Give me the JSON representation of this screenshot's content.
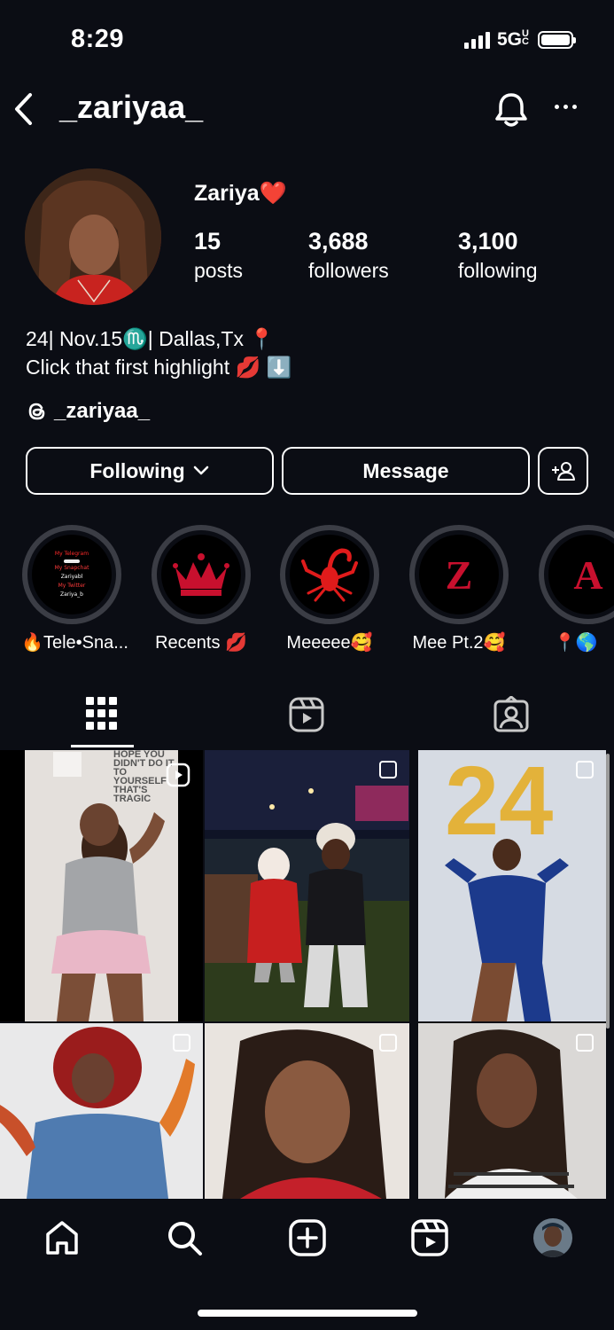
{
  "status": {
    "time": "8:29",
    "network": "5G",
    "network_suffix": "UC"
  },
  "header": {
    "username": "_zariyaa_"
  },
  "profile": {
    "display_name": "Zariya",
    "name_emoji": "❤️",
    "stats": [
      {
        "value": "15",
        "label": "posts"
      },
      {
        "value": "3,688",
        "label": "followers"
      },
      {
        "value": "3,100",
        "label": "following"
      }
    ],
    "bio_line1": "24| Nov.15♏️| Dallas,Tx 📍",
    "bio_line2": "Click that first highlight 💋 ⬇️",
    "threads_handle": "_zariyaa_"
  },
  "actions": {
    "following_label": "Following",
    "message_label": "Message"
  },
  "highlights": [
    {
      "label": "🔥Tele•Sna...",
      "cover_lines": [
        "My Telegram",
        "My Snapchat",
        "Zariyabl",
        "My Twitter",
        "Zariya_b"
      ]
    },
    {
      "label": "Recents 💋",
      "cover": "crown"
    },
    {
      "label": "Meeeee🥰",
      "cover": "scorpion"
    },
    {
      "label": "Mee Pt.2🥰",
      "cover_letter": "Z"
    },
    {
      "label": "📍🌎",
      "cover_letter": "A"
    }
  ],
  "post_overlay_text": "HOPE YOU DIDN'T DO IT TO YOURSELF THAT'S TRAGIC",
  "colors": {
    "background": "#0b0d14",
    "accent_red": "#c8102e",
    "ring": "#3b3d45"
  },
  "icons": [
    "back-icon",
    "bell-icon",
    "more-icon",
    "threads-icon",
    "chevron-down-icon",
    "add-person-icon",
    "grid-icon",
    "reels-icon",
    "tagged-icon",
    "home-icon",
    "search-icon",
    "create-icon",
    "reels-nav-icon"
  ]
}
